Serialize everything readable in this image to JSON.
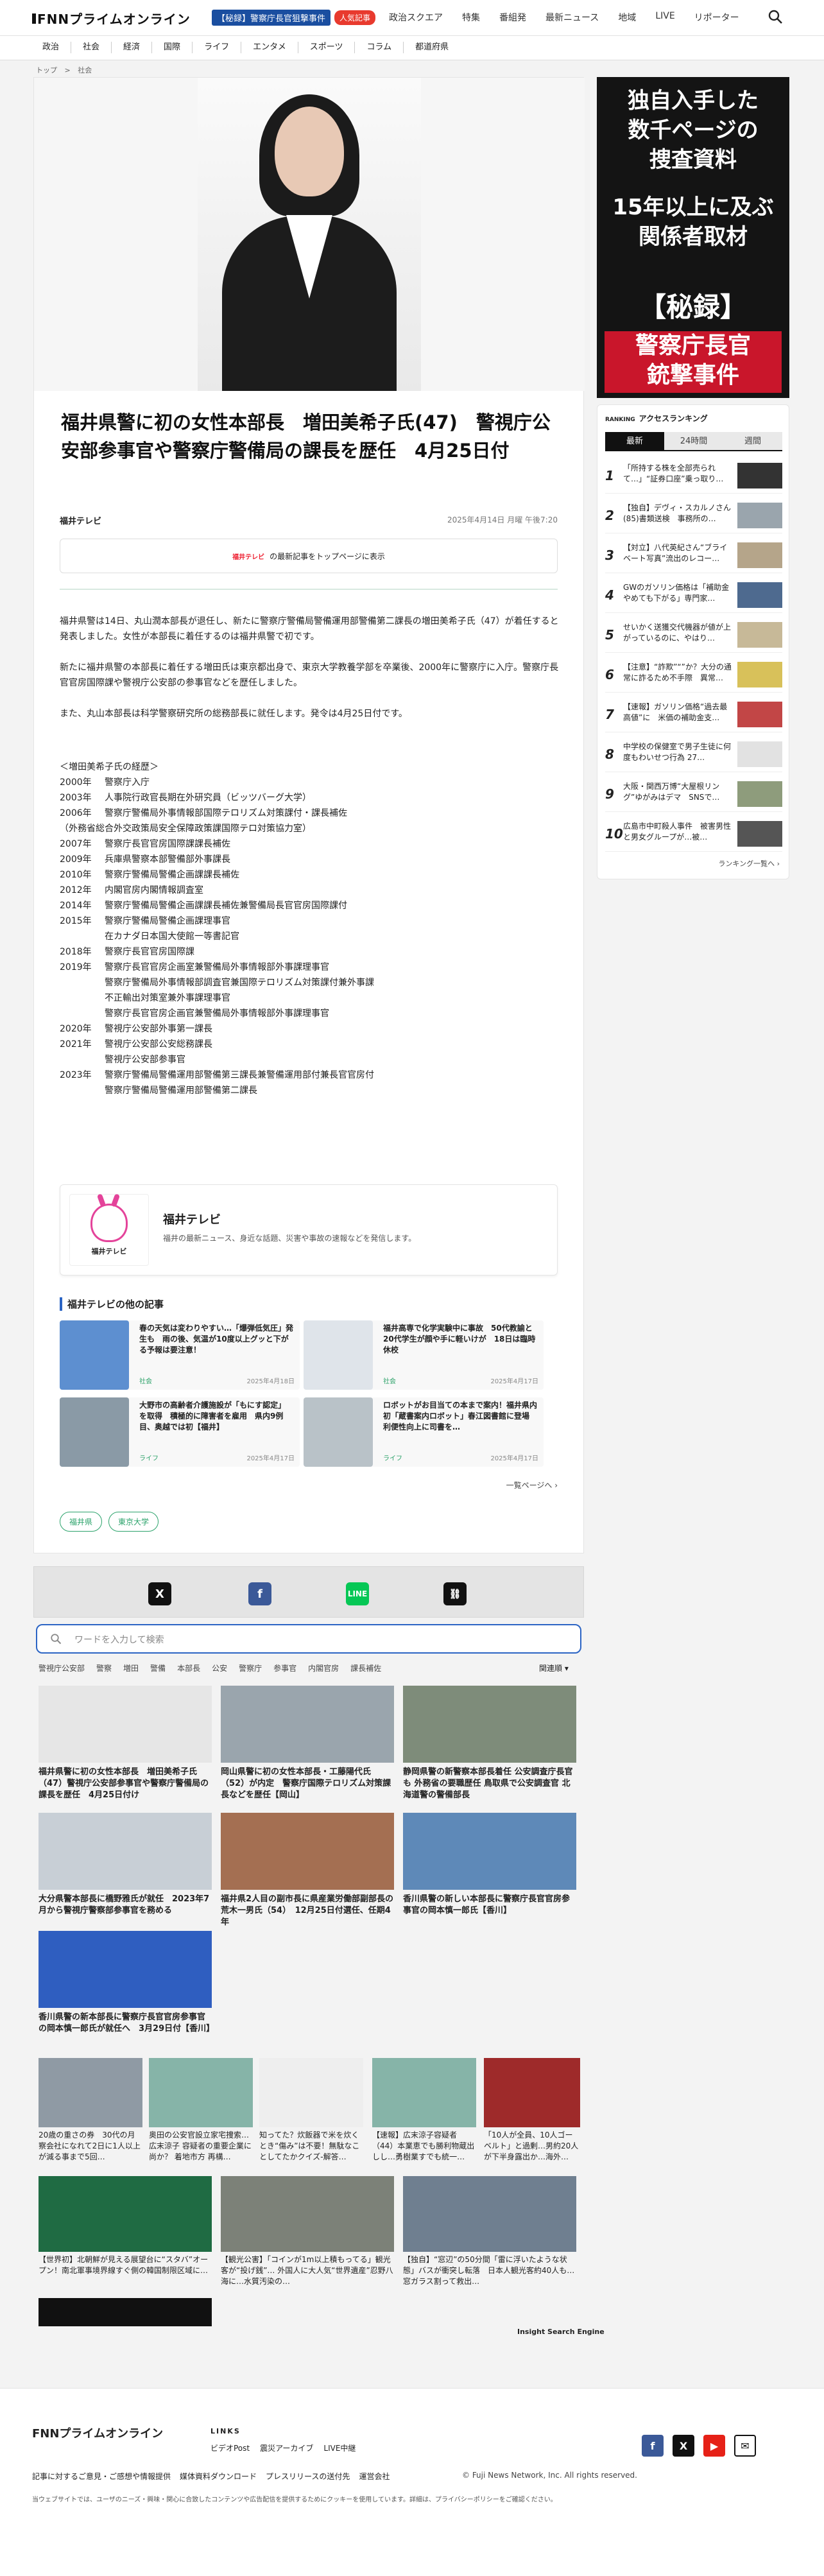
{
  "header": {
    "logo": "FNNプライムオンライン",
    "trend_tag": "【秘録】警察庁長官狙撃事件",
    "trend_badge": "人気記事",
    "nav": [
      "政治スクエア",
      "特集",
      "番組発",
      "最新ニュース",
      "地域",
      "LIVE",
      "リポーター"
    ]
  },
  "categories": [
    "政治",
    "社会",
    "経済",
    "国際",
    "ライフ",
    "エンタメ",
    "スポーツ",
    "コラム",
    "都道府県"
  ],
  "breadcrumb": {
    "top": "トップ",
    "sep": ">",
    "current": "社会"
  },
  "article": {
    "title": "福井県警に初の女性本部長　増田美希子氏(47)　警視庁公安部参事官や警察庁警備局の課長を歴任　4月25日付",
    "source": "福井テレビ",
    "date": "2025年4月14日 月曜 午後7:20",
    "follow_logo": "福井テレビ",
    "follow_text": "の最新記事をトップページに表示",
    "paragraphs": [
      "福井県警は14日、丸山潤本部長が退任し、新たに警察庁警備局警備運用部警備第二課長の増田美希子氏（47）が着任すると発表しました。女性が本部長に着任するのは福井県警で初です。",
      "新たに福井県警の本部長に着任する増田氏は東京都出身で、東京大学教養学部を卒業後、2000年に警察庁に入庁。警察庁長官官房国際課や警視庁公安部の参事官などを歴任しました。",
      "また、丸山本部長は科学警察研究所の総務部長に就任します。発令は4月25日付です。"
    ],
    "history_title": "＜増田美希子氏の経歴＞",
    "history": [
      {
        "y": "2000年",
        "t": "警察庁入庁"
      },
      {
        "y": "2003年",
        "t": "人事院行政官長期在外研究員（ビッツバーグ大学）"
      },
      {
        "y": "2006年",
        "t": "警察庁警備局外事情報部国際テロリズム対策課付・課長補佐"
      },
      {
        "y": "",
        "t": "（外務省総合外交政策局安全保障政策課国際テロ対策協力室）",
        "full": true
      },
      {
        "y": "2007年",
        "t": "警察庁長官官房国際課課長補佐"
      },
      {
        "y": "2009年",
        "t": "兵庫県警察本部警備部外事課長"
      },
      {
        "y": "2010年",
        "t": "警察庁警備局警備企画課課長補佐"
      },
      {
        "y": "2012年",
        "t": "内閣官房内閣情報調査室"
      },
      {
        "y": "2014年",
        "t": "警察庁警備局警備企画課課長補佐兼警備局長官官房国際課付"
      },
      {
        "y": "2015年",
        "t": "警察庁警備局警備企画課理事官"
      },
      {
        "y": "",
        "t": "在カナダ日本国大使館一等書記官"
      },
      {
        "y": "2018年",
        "t": "警察庁長官官房国際課"
      },
      {
        "y": "2019年",
        "t": "警察庁長官官房企画室兼警備局外事情報部外事課理事官"
      },
      {
        "y": "",
        "t": "警察庁警備局外事情報部調査官兼国際テロリズム対策課付兼外事課"
      },
      {
        "y": "",
        "t": "不正輸出対策室兼外事課理事官"
      },
      {
        "y": "",
        "t": "警察庁長官官房企画官兼警備局外事情報部外事課理事官"
      },
      {
        "y": "2020年",
        "t": "警視庁公安部外事第一課長"
      },
      {
        "y": "2021年",
        "t": "警視庁公安部公安総務課長"
      },
      {
        "y": "",
        "t": "警視庁公安部参事官"
      },
      {
        "y": "2023年",
        "t": "警察庁警備局警備運用部警備第三課長兼警備運用部付兼長官官房付"
      },
      {
        "y": "",
        "t": "警察庁警備局警備運用部警備第二課長"
      }
    ],
    "station": {
      "logo_caption": "福井テレビ",
      "name": "福井テレビ",
      "desc": "福井の最新ニュース、身近な話題、災害や事故の速報などを発信します。"
    },
    "others_title": "福井テレビの他の記事",
    "others": [
      {
        "t": "春の天気は変わりやすい…「爆弾低気圧」発生も　雨の後、気温が10度以上グッと下がる予報は要注意！",
        "cat": "社会",
        "date": "2025年4月18日"
      },
      {
        "t": "福井高専で化学実験中に事故　50代教諭と20代学生が顔や手に軽いけが　18日は臨時休校",
        "cat": "社会",
        "date": "2025年4月17日"
      },
      {
        "t": "大野市の高齢者介護施設が「もにす認定」を取得　積極的に障害者を雇用　県内9例目、奥越では初【福井】",
        "cat": "ライフ",
        "date": "2025年4月17日"
      },
      {
        "t": "ロボットがお目当ての本まで案内！福井県内初「蔵書案内ロボット」春江図書館に登場　利便性向上に司書を…",
        "cat": "ライフ",
        "date": "2025年4月17日"
      }
    ],
    "others_more": "一覧ページへ",
    "tags": [
      "福井県",
      "東京大学"
    ]
  },
  "share": {
    "icons": [
      "x-icon",
      "facebook-icon",
      "line-icon",
      "copy-link-icon"
    ]
  },
  "search": {
    "placeholder": "ワードを入力して検索",
    "keywords": [
      "警視庁公安部",
      "警察",
      "増田",
      "警備",
      "本部長",
      "公安",
      "警察庁",
      "参事官",
      "内閣官房",
      "課長補佐"
    ],
    "sort": "関連順"
  },
  "related": [
    {
      "t": "福井県警に初の女性本部長　増田美希子氏（47）警視庁公安部参事官や警察庁警備局の課長を歴任　4月25日付け"
    },
    {
      "t": "岡山県警に初の女性本部長・工藤陽代氏（52）が内定　警察庁国際テロリズム対策課長などを歴任【岡山】"
    },
    {
      "t": "静岡県警の新警察本部長着任 公安調査庁長官も 外務省の要職歴任 鳥取県で公安調査官 北海道警の警備部長"
    },
    {
      "t": "大分県警本部長に橋野雅氏が就任　2023年7月から警視庁警察部参事官を務める"
    },
    {
      "t": "福井県2人目の副市長に県産業労働部副部長の荒木一男氏（54）　12月25日付選任、任期4年"
    },
    {
      "t": "香川県警の新しい本部長に警察庁長官官房参事官の岡本慎一郎氏【香川】"
    },
    {
      "t": "香川県警の新本部長に警察庁長官官房参事官の岡本慎一郎氏が就任へ　3月29日付【香川】"
    }
  ],
  "ads": [
    {
      "t": "20歳の重さの券　30代の月察会社になれて2日に1人以上が減る事まで5回…"
    },
    {
      "t": "奥田の公安官設立家宅捜索…広末涼子 容疑者の重要企業に尚か？ 着地市方 再構…"
    },
    {
      "t": "知ってた？炊飯器で米を炊くとき“傷み”は不要！無駄なことしてたかクイズ-解答…"
    },
    {
      "t": "【速報】広末涼子容疑者（44）本業恵でも勝利物蔵出しし…勇樹業すでも統一…"
    },
    {
      "t": "「10人が全員、10人ゴーベルト」と過剰…男約20人が下半身露出か…海外…"
    },
    {
      "t": "【世界初】北朝鮮が見える展望台に“スタバ”オープン！南北軍事境界線すぐ側の韓国制限区域に…"
    },
    {
      "t": "【観光公害】「コインが1m以上積もってる」観光客が“投げ銭”… 外国人に大人気“世界遺産”忍野八海に…水質汚染の…"
    },
    {
      "t": "【独自】“窓辺”の50分間「雷に浮いたような状態」バスが衝突し転落　日本人観光客約40人も…窓ガラス割って救出…"
    }
  ],
  "ise_label": "Insight Search Engine",
  "sidebar": {
    "banner": [
      "独自入手した",
      "数千ページの",
      "捜査資料",
      "15年以上に及ぶ",
      "関係者取材",
      "【秘録】",
      "警察庁長官",
      "銃撃事件"
    ],
    "rank_label": "アクセスランキング",
    "rank_badge": "RANKING",
    "tabs": [
      "最新",
      "24時間",
      "週間"
    ],
    "items": [
      {
        "n": "1",
        "t": "「所持する株を全部売られて…」“証券口座”乗っ取り…"
      },
      {
        "n": "2",
        "t": "【独自】デヴィ・スカルノさん(85)書類送検　事務所の…"
      },
      {
        "n": "3",
        "t": "【対立】八代英紀さん“ブライベート写真”流出のレコー…"
      },
      {
        "n": "4",
        "t": "GWのガソリン価格は「補助金やめても下がる」専門家…"
      },
      {
        "n": "5",
        "t": "せいかく送獲交代機器が値が上がっているのに、やはり…"
      },
      {
        "n": "6",
        "t": "【注意】“詐欺”“”か？大分の通常に詐るため不手際　異常…"
      },
      {
        "n": "7",
        "t": "【速報】ガソリン価格“過去最高値”に　米価の補助金支…"
      },
      {
        "n": "8",
        "t": "中学校の保健室で男子生徒に何度もわいせつ行為 27…"
      },
      {
        "n": "9",
        "t": "大阪・関西万博“大屋根リング”ゆがみはデマ　SNSで…"
      },
      {
        "n": "10",
        "t": "広島市中町殺人事件　被害男性と男女グループが…被…"
      }
    ],
    "more": "ランキング一覧へ"
  },
  "footer": {
    "logo": "FNNプライムオンライン",
    "links_title": "LINKS",
    "links": [
      "ビデオPost",
      "震災アーカイブ",
      "LIVE中継"
    ],
    "links2": [
      "記事に対するご意見・ご感想や情報提供",
      "媒体資料ダウンロード",
      "プレスリリースの送付先",
      "運営会社"
    ],
    "copyright": "© Fuji News Network, Inc. All rights reserved.",
    "note": "当ウェブサイトでは、ユーザのニーズ・興味・関心に合致したコンテンツや広告配信を提供するためにクッキーを使用しています。詳細は、プライバシーポリシーをご確認ください。"
  }
}
